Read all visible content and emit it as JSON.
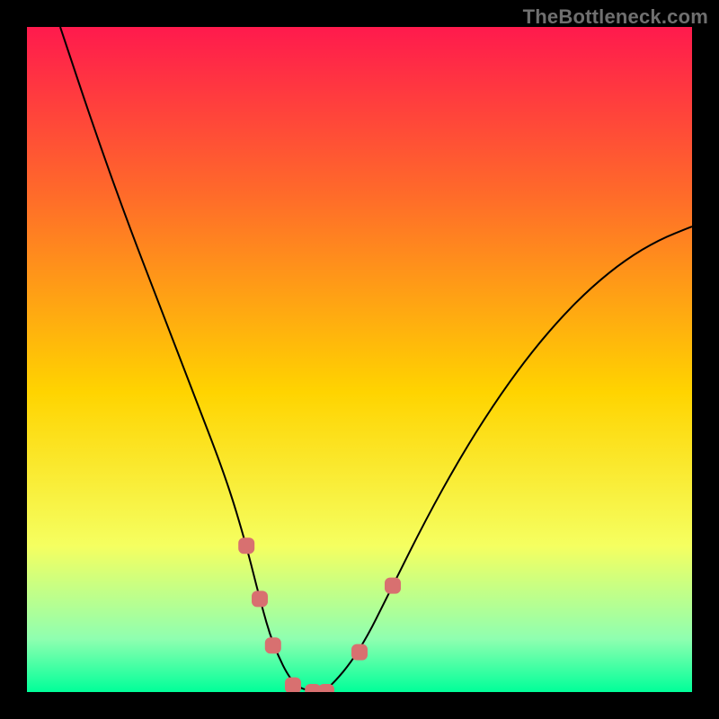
{
  "watermark": "TheBottleneck.com",
  "chart_data": {
    "type": "line",
    "title": "",
    "xlabel": "",
    "ylabel": "",
    "xlim": [
      0,
      100
    ],
    "ylim": [
      0,
      100
    ],
    "grid": false,
    "legend": false,
    "background_gradient": [
      "#ff1a4d",
      "#ff6a2a",
      "#ffd400",
      "#f5ff60",
      "#8fffb0",
      "#00ff99"
    ],
    "series": [
      {
        "name": "curve",
        "x": [
          5,
          10,
          15,
          20,
          25,
          30,
          33,
          35,
          37,
          40,
          43,
          45,
          50,
          55,
          60,
          65,
          70,
          75,
          80,
          85,
          90,
          95,
          100
        ],
        "y": [
          100,
          85,
          71,
          58,
          45,
          32,
          22,
          14,
          7,
          1,
          0,
          0,
          6,
          16,
          26,
          35,
          43,
          50,
          56,
          61,
          65,
          68,
          70
        ]
      }
    ],
    "markers": {
      "name": "highlighted-points",
      "color": "#d87070",
      "x": [
        33,
        35,
        37,
        40,
        43,
        45,
        50,
        55
      ],
      "y": [
        22,
        14,
        7,
        1,
        0,
        0,
        6,
        16
      ]
    }
  }
}
